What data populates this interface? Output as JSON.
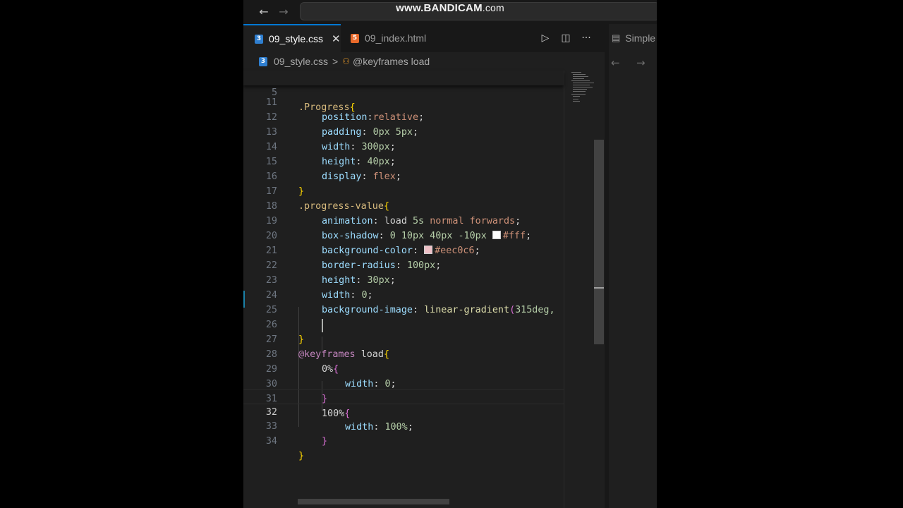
{
  "watermark": {
    "main": "www.BANDICAM",
    "suffix": ".com"
  },
  "titlebar": {
    "back_icon": "←",
    "forward_icon": "→"
  },
  "tabs": [
    {
      "label": "09_style.css",
      "type": "css",
      "active": true,
      "close_icon": "✕"
    },
    {
      "label": "09_index.html",
      "type": "html",
      "active": false
    }
  ],
  "file_icons": {
    "css": "3",
    "html": "5"
  },
  "editor_actions": {
    "run_icon": "▷",
    "split_icon": "◫",
    "more_icon": "···"
  },
  "right_group": {
    "tab_label": "Simple",
    "tab_icon": "▤",
    "back_icon": "←",
    "forward_icon": "→"
  },
  "breadcrumb": {
    "file": "09_style.css",
    "separator": ">",
    "symbol_icon": "⚇",
    "symbol": "@keyframes load"
  },
  "code": {
    "sticky": {
      "num": "5",
      "selector": ".Progress",
      "brace": "{"
    },
    "lines": [
      {
        "num": "11",
        "prop": "position",
        "value": "relative"
      },
      {
        "num": "12",
        "prop": "padding",
        "value": "0px 5px"
      },
      {
        "num": "13",
        "prop": "width",
        "value": "300px"
      },
      {
        "num": "14",
        "prop": "height",
        "value": "40px"
      },
      {
        "num": "15",
        "prop": "display",
        "value": "flex"
      },
      {
        "num": "16",
        "text": "}"
      },
      {
        "num": "17",
        "selector": ".progress-value",
        "brace": "{"
      },
      {
        "num": "18",
        "prop": "animation",
        "v1": "load",
        "v2": "5s",
        "v3": "normal forwards"
      },
      {
        "num": "19",
        "prop": "box-shadow",
        "v1": "0 10px 40px -10px",
        "color": "#fff",
        "swatch": "#ffffff"
      },
      {
        "num": "20",
        "prop": "background-color",
        "color": "#eec0c6",
        "swatch": "#eec0c6"
      },
      {
        "num": "21",
        "prop": "border-radius",
        "value": "100px"
      },
      {
        "num": "22",
        "prop": "height",
        "value": "30px"
      },
      {
        "num": "23",
        "prop": "width",
        "value": "0"
      },
      {
        "num": "24",
        "prop": "background-image",
        "fn": "linear-gradient",
        "paren": "(",
        "arg": "315deg,"
      },
      {
        "num": "25",
        "text": ""
      },
      {
        "num": "26",
        "text": "}"
      },
      {
        "num": "27",
        "at": "@keyframes",
        "name": "load",
        "brace": "{"
      },
      {
        "num": "28",
        "key": "0%",
        "brace": "{"
      },
      {
        "num": "29",
        "prop": "width",
        "value": "0"
      },
      {
        "num": "30",
        "text": "}"
      },
      {
        "num": "31",
        "key": "100%",
        "brace": "{"
      },
      {
        "num": "32",
        "prop": "width",
        "value": "100%"
      },
      {
        "num": "33",
        "text": "}"
      },
      {
        "num": "34",
        "text": "}"
      }
    ]
  }
}
